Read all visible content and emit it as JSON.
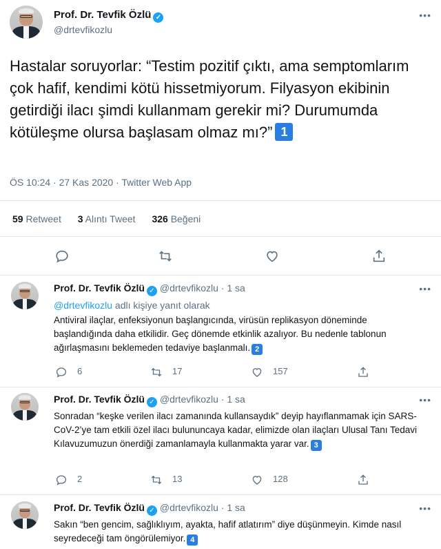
{
  "main_tweet": {
    "name": "Prof. Dr. Tevfik Özlü",
    "handle": "@drtevfikozlu",
    "text": "Hastalar soruyorlar: “Testim pozitif çıktı, ama semptomlarım çok hafif, kendimi kötü hissetmiyorum. Filyasyon ekibinin getirdiği ilacı şimdi kullanmam gerekir mi? Durumumda kötüleşme olursa başlasam olmaz mı?”",
    "badge": "1",
    "meta": "ÖS 10:24 · 27 Kas 2020 · Twitter Web App",
    "stats": {
      "retweets_count": "59",
      "retweets_label": "Retweet",
      "quotes_count": "3",
      "quotes_label": "Alıntı Tweet",
      "likes_count": "326",
      "likes_label": "Beğeni"
    }
  },
  "replies": [
    {
      "name": "Prof. Dr. Tevfik Özlü",
      "handle": "@drtevfikozlu",
      "time": "· 1 sa",
      "reply_to_handle": "@drtevfikozlu",
      "reply_to_suffix": " adlı kişiye yanıt olarak",
      "text": "Antiviral ilaçlar, enfeksiyonun başlangıcında, virüsün replikasyon döneminde başlandığında daha etkilidir. Geç dönemde etkinlik azalıyor. Bu nedenle tablonun ağırlaşmasını beklemeden tedaviye başlanmalı.",
      "badge": "2",
      "replies_count": "6",
      "retweets_count": "17",
      "likes_count": "157"
    },
    {
      "name": "Prof. Dr. Tevfik Özlü",
      "handle": "@drtevfikozlu",
      "time": "· 1 sa",
      "text": "Sonradan “keşke verilen ilacı zamanında kullansaydık” deyip hayıflanmamak için SARS-CoV-2’ye tam etkili özel ilacı bulununcaya kadar, elimizde olan ilaçları Ulusal Tanı Tedavi Kılavuzumuzun önerdiği zamanlamayla kullanmakta yarar var.",
      "badge": "3",
      "replies_count": "2",
      "retweets_count": "13",
      "likes_count": "128"
    },
    {
      "name": "Prof. Dr. Tevfik Özlü",
      "handle": "@drtevfikozlu",
      "time": "· 1 sa",
      "text": "Sakın “ben gencim, sağlıklıyım, ayakta, hafif atlatırım” diye düşünmeyin. Kimde nasıl seyredeceği tam öngörülemiyor.",
      "badge": "4"
    }
  ],
  "icons": {
    "more": "more-icon",
    "reply": "reply-icon",
    "retweet": "retweet-icon",
    "like": "heart-icon",
    "share": "share-icon",
    "verified": "verified-badge-icon"
  },
  "colors": {
    "accent": "#1da1f2",
    "badge": "#2a7de1",
    "muted": "#5b7083",
    "divider": "#e1e8ed"
  }
}
